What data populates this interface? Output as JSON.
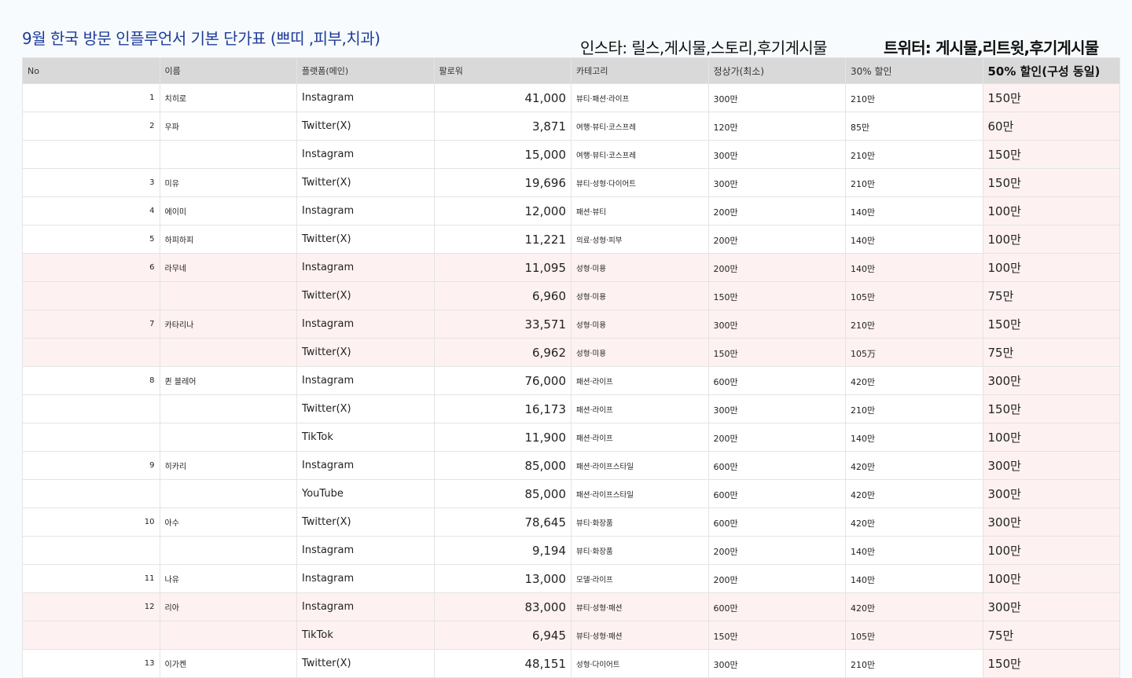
{
  "title": "9월 한국 방문 인플루언서 기본 단가표 (쁘띠 ,피부,치과)",
  "note_insta": "인스타: 릴스,게시물,스토리,후기게시물",
  "note_twitter": "트위터: 게시물,리트윗,후기게시물",
  "columns": [
    "No",
    "이름",
    "플랫폼(메인)",
    "팔로워",
    "카테고리",
    "정상가(최소)",
    "30% 할인",
    "50% 할인(구성 동일)"
  ],
  "rows": [
    {
      "no": "1",
      "name": "치히로",
      "platform": "Instagram",
      "followers": "41,000",
      "category": "뷰티·패션·라이프",
      "price": "300만",
      "d30": "210만",
      "d50": "150만",
      "pink": false
    },
    {
      "no": "2",
      "name": "우파",
      "platform": "Twitter(X)",
      "followers": "3,871",
      "category": "여행·뷰티·코스프레",
      "price": "120만",
      "d30": "85만",
      "d50": "60만",
      "pink": false
    },
    {
      "no": "",
      "name": "",
      "platform": "Instagram",
      "followers": "15,000",
      "category": "여행·뷰티·코스프레",
      "price": "300만",
      "d30": "210만",
      "d50": "150만",
      "pink": false
    },
    {
      "no": "3",
      "name": "미유",
      "platform": "Twitter(X)",
      "followers": "19,696",
      "category": "뷰티·성형·다이어트",
      "price": "300만",
      "d30": "210만",
      "d50": "150만",
      "pink": false
    },
    {
      "no": "4",
      "name": "에이미",
      "platform": "Instagram",
      "followers": "12,000",
      "category": "패션·뷰티",
      "price": "200만",
      "d30": "140만",
      "d50": "100만",
      "pink": false
    },
    {
      "no": "5",
      "name": "하피하피",
      "platform": "Twitter(X)",
      "followers": "11,221",
      "category": "의료·성형·피부",
      "price": "200만",
      "d30": "140만",
      "d50": "100만",
      "pink": false
    },
    {
      "no": "6",
      "name": "라무네",
      "platform": "Instagram",
      "followers": "11,095",
      "category": "성형·미용",
      "price": "200만",
      "d30": "140만",
      "d50": "100만",
      "pink": true
    },
    {
      "no": "",
      "name": "",
      "platform": "Twitter(X)",
      "followers": "6,960",
      "category": "성형·미용",
      "price": "150만",
      "d30": "105만",
      "d50": "75만",
      "pink": true
    },
    {
      "no": "7",
      "name": "카타리나",
      "platform": "Instagram",
      "followers": "33,571",
      "category": "성형·미용",
      "price": "300만",
      "d30": "210만",
      "d50": "150만",
      "pink": true
    },
    {
      "no": "",
      "name": "",
      "platform": "Twitter(X)",
      "followers": "6,962",
      "category": "성형·미용",
      "price": "150만",
      "d30": "105万",
      "d50": "75만",
      "pink": true
    },
    {
      "no": "8",
      "name": "퀸 블레어",
      "platform": "Instagram",
      "followers": "76,000",
      "category": "패션·라이프",
      "price": "600만",
      "d30": "420만",
      "d50": "300만",
      "pink": false
    },
    {
      "no": "",
      "name": "",
      "platform": "Twitter(X)",
      "followers": "16,173",
      "category": "패션·라이프",
      "price": "300만",
      "d30": "210만",
      "d50": "150만",
      "pink": false
    },
    {
      "no": "",
      "name": "",
      "platform": "TikTok",
      "followers": "11,900",
      "category": "패션·라이프",
      "price": "200만",
      "d30": "140만",
      "d50": "100만",
      "pink": false
    },
    {
      "no": "9",
      "name": "히카리",
      "platform": "Instagram",
      "followers": "85,000",
      "category": "패션·라이프스타일",
      "price": "600만",
      "d30": "420만",
      "d50": "300만",
      "pink": false
    },
    {
      "no": "",
      "name": "",
      "platform": "YouTube",
      "followers": "85,000",
      "category": "패션·라이프스타일",
      "price": "600만",
      "d30": "420만",
      "d50": "300만",
      "pink": false
    },
    {
      "no": "10",
      "name": "아수",
      "platform": "Twitter(X)",
      "followers": "78,645",
      "category": "뷰티·화장품",
      "price": "600만",
      "d30": "420만",
      "d50": "300만",
      "pink": false
    },
    {
      "no": "",
      "name": "",
      "platform": "Instagram",
      "followers": "9,194",
      "category": "뷰티·화장품",
      "price": "200만",
      "d30": "140만",
      "d50": "100만",
      "pink": false
    },
    {
      "no": "11",
      "name": "나유",
      "platform": "Instagram",
      "followers": "13,000",
      "category": "모델·라이프",
      "price": "200만",
      "d30": "140만",
      "d50": "100만",
      "pink": false
    },
    {
      "no": "12",
      "name": "리아",
      "platform": "Instagram",
      "followers": "83,000",
      "category": "뷰티·성형·패션",
      "price": "600만",
      "d30": "420만",
      "d50": "300만",
      "pink": true
    },
    {
      "no": "",
      "name": "",
      "platform": "TikTok",
      "followers": "6,945",
      "category": "뷰티·성형·패션",
      "price": "150만",
      "d30": "105만",
      "d50": "75만",
      "pink": true
    },
    {
      "no": "13",
      "name": "이가켄",
      "platform": "Twitter(X)",
      "followers": "48,151",
      "category": "성형·다이어트",
      "price": "300만",
      "d30": "210만",
      "d50": "150만",
      "pink": false
    }
  ]
}
